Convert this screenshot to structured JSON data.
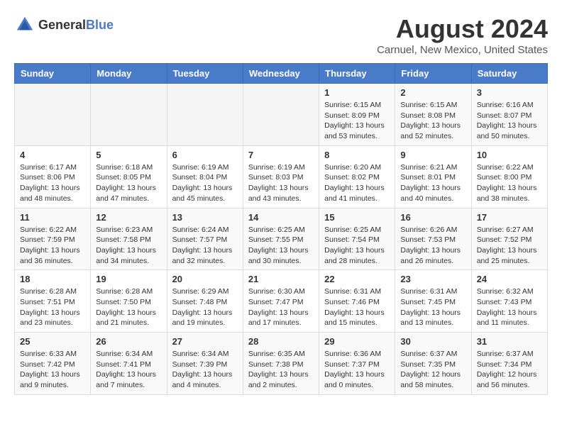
{
  "header": {
    "logo": {
      "text_general": "General",
      "text_blue": "Blue"
    },
    "title": "August 2024",
    "location": "Carnuel, New Mexico, United States"
  },
  "days_of_week": [
    "Sunday",
    "Monday",
    "Tuesday",
    "Wednesday",
    "Thursday",
    "Friday",
    "Saturday"
  ],
  "weeks": [
    [
      {
        "day": "",
        "info": ""
      },
      {
        "day": "",
        "info": ""
      },
      {
        "day": "",
        "info": ""
      },
      {
        "day": "",
        "info": ""
      },
      {
        "day": "1",
        "info": "Sunrise: 6:15 AM\nSunset: 8:09 PM\nDaylight: 13 hours\nand 53 minutes."
      },
      {
        "day": "2",
        "info": "Sunrise: 6:15 AM\nSunset: 8:08 PM\nDaylight: 13 hours\nand 52 minutes."
      },
      {
        "day": "3",
        "info": "Sunrise: 6:16 AM\nSunset: 8:07 PM\nDaylight: 13 hours\nand 50 minutes."
      }
    ],
    [
      {
        "day": "4",
        "info": "Sunrise: 6:17 AM\nSunset: 8:06 PM\nDaylight: 13 hours\nand 48 minutes."
      },
      {
        "day": "5",
        "info": "Sunrise: 6:18 AM\nSunset: 8:05 PM\nDaylight: 13 hours\nand 47 minutes."
      },
      {
        "day": "6",
        "info": "Sunrise: 6:19 AM\nSunset: 8:04 PM\nDaylight: 13 hours\nand 45 minutes."
      },
      {
        "day": "7",
        "info": "Sunrise: 6:19 AM\nSunset: 8:03 PM\nDaylight: 13 hours\nand 43 minutes."
      },
      {
        "day": "8",
        "info": "Sunrise: 6:20 AM\nSunset: 8:02 PM\nDaylight: 13 hours\nand 41 minutes."
      },
      {
        "day": "9",
        "info": "Sunrise: 6:21 AM\nSunset: 8:01 PM\nDaylight: 13 hours\nand 40 minutes."
      },
      {
        "day": "10",
        "info": "Sunrise: 6:22 AM\nSunset: 8:00 PM\nDaylight: 13 hours\nand 38 minutes."
      }
    ],
    [
      {
        "day": "11",
        "info": "Sunrise: 6:22 AM\nSunset: 7:59 PM\nDaylight: 13 hours\nand 36 minutes."
      },
      {
        "day": "12",
        "info": "Sunrise: 6:23 AM\nSunset: 7:58 PM\nDaylight: 13 hours\nand 34 minutes."
      },
      {
        "day": "13",
        "info": "Sunrise: 6:24 AM\nSunset: 7:57 PM\nDaylight: 13 hours\nand 32 minutes."
      },
      {
        "day": "14",
        "info": "Sunrise: 6:25 AM\nSunset: 7:55 PM\nDaylight: 13 hours\nand 30 minutes."
      },
      {
        "day": "15",
        "info": "Sunrise: 6:25 AM\nSunset: 7:54 PM\nDaylight: 13 hours\nand 28 minutes."
      },
      {
        "day": "16",
        "info": "Sunrise: 6:26 AM\nSunset: 7:53 PM\nDaylight: 13 hours\nand 26 minutes."
      },
      {
        "day": "17",
        "info": "Sunrise: 6:27 AM\nSunset: 7:52 PM\nDaylight: 13 hours\nand 25 minutes."
      }
    ],
    [
      {
        "day": "18",
        "info": "Sunrise: 6:28 AM\nSunset: 7:51 PM\nDaylight: 13 hours\nand 23 minutes."
      },
      {
        "day": "19",
        "info": "Sunrise: 6:28 AM\nSunset: 7:50 PM\nDaylight: 13 hours\nand 21 minutes."
      },
      {
        "day": "20",
        "info": "Sunrise: 6:29 AM\nSunset: 7:48 PM\nDaylight: 13 hours\nand 19 minutes."
      },
      {
        "day": "21",
        "info": "Sunrise: 6:30 AM\nSunset: 7:47 PM\nDaylight: 13 hours\nand 17 minutes."
      },
      {
        "day": "22",
        "info": "Sunrise: 6:31 AM\nSunset: 7:46 PM\nDaylight: 13 hours\nand 15 minutes."
      },
      {
        "day": "23",
        "info": "Sunrise: 6:31 AM\nSunset: 7:45 PM\nDaylight: 13 hours\nand 13 minutes."
      },
      {
        "day": "24",
        "info": "Sunrise: 6:32 AM\nSunset: 7:43 PM\nDaylight: 13 hours\nand 11 minutes."
      }
    ],
    [
      {
        "day": "25",
        "info": "Sunrise: 6:33 AM\nSunset: 7:42 PM\nDaylight: 13 hours\nand 9 minutes."
      },
      {
        "day": "26",
        "info": "Sunrise: 6:34 AM\nSunset: 7:41 PM\nDaylight: 13 hours\nand 7 minutes."
      },
      {
        "day": "27",
        "info": "Sunrise: 6:34 AM\nSunset: 7:39 PM\nDaylight: 13 hours\nand 4 minutes."
      },
      {
        "day": "28",
        "info": "Sunrise: 6:35 AM\nSunset: 7:38 PM\nDaylight: 13 hours\nand 2 minutes."
      },
      {
        "day": "29",
        "info": "Sunrise: 6:36 AM\nSunset: 7:37 PM\nDaylight: 13 hours\nand 0 minutes."
      },
      {
        "day": "30",
        "info": "Sunrise: 6:37 AM\nSunset: 7:35 PM\nDaylight: 12 hours\nand 58 minutes."
      },
      {
        "day": "31",
        "info": "Sunrise: 6:37 AM\nSunset: 7:34 PM\nDaylight: 12 hours\nand 56 minutes."
      }
    ]
  ]
}
